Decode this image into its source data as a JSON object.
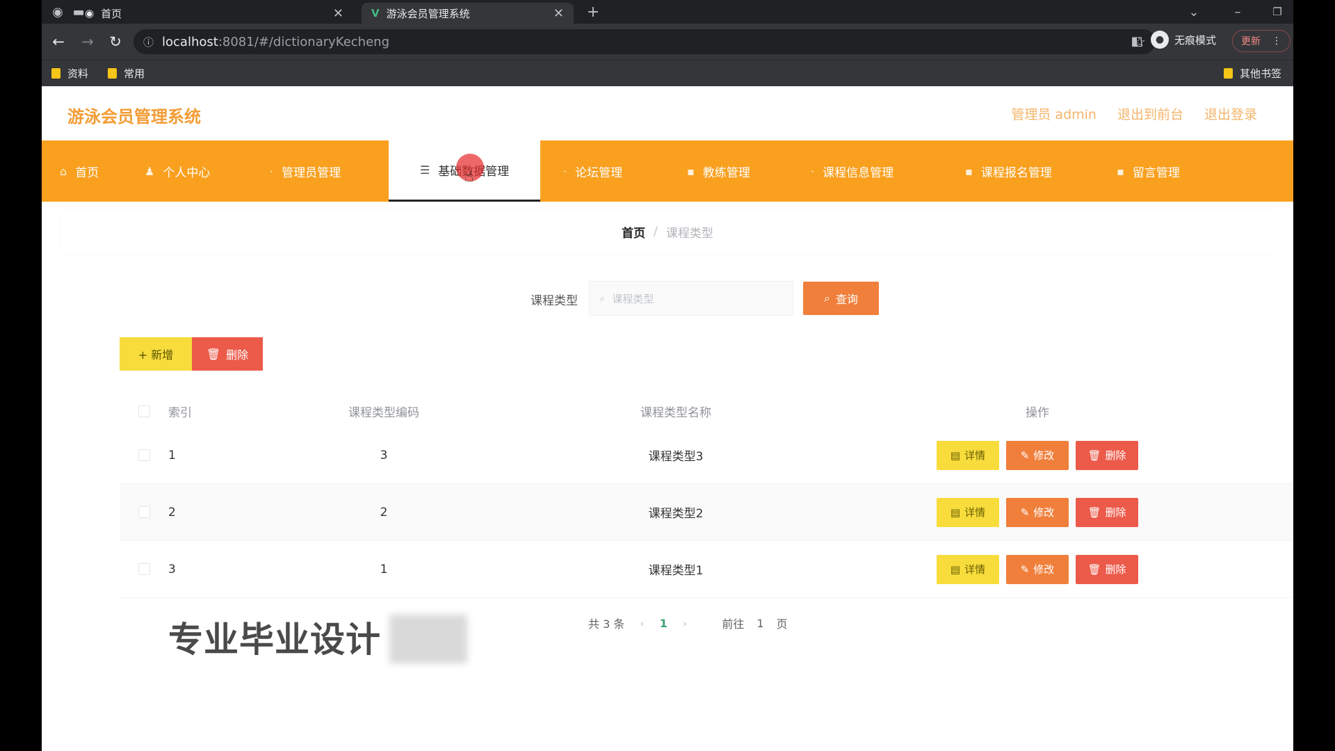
{
  "browser": {
    "tabs": [
      {
        "title": "首页",
        "active": false
      },
      {
        "title": "游泳会员管理系统",
        "active": true
      }
    ],
    "url_host": "localhost",
    "url_path": ":8081/#/dictionaryKecheng",
    "profile_label": "无痕模式",
    "update_label": "更新",
    "bookmarks": [
      "资料",
      "常用"
    ],
    "other_bookmarks": "其他书签"
  },
  "app": {
    "title": "游泳会员管理系统",
    "header_links": [
      "管理员 admin",
      "退出到前台",
      "退出登录"
    ]
  },
  "menu": {
    "items": [
      {
        "label": "首页",
        "icon": "home-icon"
      },
      {
        "label": "个人中心",
        "icon": "user-icon"
      },
      {
        "label": "管理员管理",
        "icon": "admin-icon"
      },
      {
        "label": "基础数据管理",
        "icon": "list-icon",
        "active": true
      },
      {
        "label": "论坛管理",
        "icon": "forum-icon"
      },
      {
        "label": "教练管理",
        "icon": "coach-icon"
      },
      {
        "label": "课程信息管理",
        "icon": "course-icon"
      },
      {
        "label": "课程报名管理",
        "icon": "signup-icon"
      },
      {
        "label": "留言管理",
        "icon": "message-icon"
      }
    ]
  },
  "breadcrumb": {
    "home": "首页",
    "current": "课程类型"
  },
  "search": {
    "label": "课程类型",
    "placeholder": "课程类型",
    "button": "查询"
  },
  "actions": {
    "add": "+ 新增",
    "delete": "删除"
  },
  "table": {
    "headers": [
      "索引",
      "课程类型编码",
      "课程类型名称",
      "操作"
    ],
    "rows": [
      {
        "index": "1",
        "code": "3",
        "name": "课程类型3"
      },
      {
        "index": "2",
        "code": "2",
        "name": "课程类型2"
      },
      {
        "index": "3",
        "code": "1",
        "name": "课程类型1"
      }
    ],
    "row_buttons": {
      "detail": "详情",
      "edit": "修改",
      "delete": "删除"
    }
  },
  "pagination": {
    "total": "共 3 条",
    "current": "1",
    "goto": "前往",
    "goto_value": "1",
    "page_suffix": "页"
  },
  "watermark": "专业毕业设计",
  "colors": {
    "accent": "#f9a01f",
    "brand_text": "#f39c34",
    "search_button": "#f07f3c",
    "add_button": "#f7dc3c",
    "delete_button": "#ec5a4a"
  }
}
